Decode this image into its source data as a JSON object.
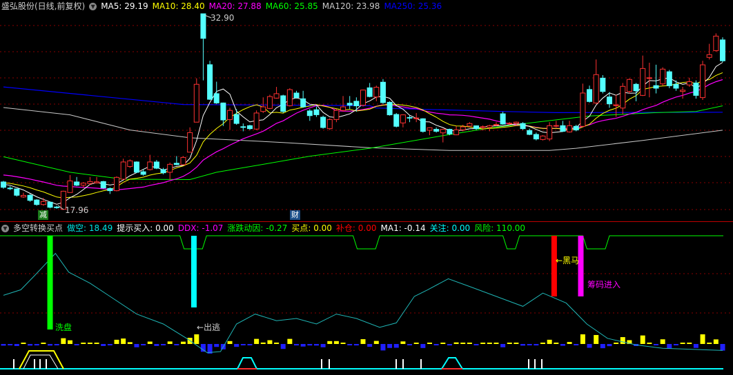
{
  "header": {
    "title": "盛弘股份(日线,前复权)",
    "ma": [
      {
        "label": "MA5: 29.19",
        "color": "#ffffff"
      },
      {
        "label": "MA10: 28.40",
        "color": "#ffff00"
      },
      {
        "label": "MA20: 27.88",
        "color": "#ff00ff"
      },
      {
        "label": "MA60: 25.85",
        "color": "#00ff00"
      },
      {
        "label": "MA120: 23.98",
        "color": "#c8c8c8"
      },
      {
        "label": "MA250: 25.36",
        "color": "#0000ff"
      }
    ]
  },
  "price_labels": {
    "high": "32.90",
    "low": "17.96"
  },
  "markers": {
    "jian": "减",
    "cai": "财"
  },
  "indicator": {
    "title": "多空转换买点",
    "values": [
      {
        "label": "做空: 18.49",
        "color": "#00e5e5"
      },
      {
        "label": "提示买入: 0.00",
        "color": "#ffffff"
      },
      {
        "label": "DDX: -1.07",
        "color": "#ff00ff"
      },
      {
        "label": "涨跌动因: -0.27",
        "color": "#00ff00"
      },
      {
        "label": "买点: 0.00",
        "color": "#ffff00"
      },
      {
        "label": "补仓: 0.00",
        "color": "#ff0000"
      },
      {
        "label": "MA1: -0.14",
        "color": "#ffffff"
      },
      {
        "label": "关注: 0.00",
        "color": "#00ffff"
      },
      {
        "label": "风险: 110.00",
        "color": "#00ff00"
      }
    ],
    "signals": {
      "wash": "洗盘",
      "escape": "←出逃",
      "darkhorse": "←黑马",
      "chips": "筹码进入"
    }
  },
  "chart_data": {
    "type": "candlestick",
    "price_range": [
      17.96,
      32.9
    ],
    "candles": [
      [
        20.02,
        19.61,
        20.1,
        19.5
      ],
      [
        19.55,
        19.52,
        19.7,
        19.4
      ],
      [
        19.49,
        19.0,
        19.5,
        18.9
      ],
      [
        18.87,
        18.99,
        19.2,
        18.8
      ],
      [
        19.0,
        18.61,
        19.1,
        18.5
      ],
      [
        18.64,
        18.29,
        18.7,
        18.2
      ],
      [
        18.29,
        18.52,
        18.8,
        18.2
      ],
      [
        18.47,
        18.08,
        18.5,
        18.0
      ],
      [
        18.1,
        18.06,
        18.2,
        17.96
      ],
      [
        17.92,
        19.31,
        19.35,
        17.92
      ],
      [
        19.21,
        20.1,
        20.55,
        19.2
      ],
      [
        20.02,
        19.77,
        20.4,
        19.7
      ],
      [
        19.77,
        19.93,
        20.0,
        19.6
      ],
      [
        19.9,
        20.05,
        20.4,
        19.8
      ],
      [
        19.95,
        20.03,
        20.4,
        19.9
      ],
      [
        20.05,
        19.56,
        20.1,
        19.5
      ],
      [
        19.52,
        19.35,
        19.6,
        19.1
      ],
      [
        19.35,
        20.37,
        20.45,
        19.3
      ],
      [
        20.23,
        21.55,
        21.8,
        20.2
      ],
      [
        21.2,
        21.64,
        21.75,
        21.1
      ],
      [
        21.55,
        20.76,
        21.6,
        20.7
      ],
      [
        20.8,
        20.6,
        21.0,
        20.5
      ],
      [
        20.97,
        21.55,
        22.1,
        20.9
      ],
      [
        21.55,
        21.07,
        21.7,
        21.0
      ],
      [
        20.97,
        20.72,
        21.1,
        20.6
      ],
      [
        20.76,
        21.37,
        21.5,
        20.2
      ],
      [
        21.45,
        21.35,
        22.0,
        21.3
      ],
      [
        21.34,
        21.9,
        22.0,
        21.3
      ],
      [
        22.3,
        23.8,
        24.2,
        22.3
      ],
      [
        24.6,
        27.5,
        27.96,
        24.6
      ],
      [
        32.9,
        31.02,
        32.9,
        27.8
      ],
      [
        29.0,
        26.35,
        29.3,
        26.3
      ],
      [
        26.78,
        26.07,
        27.7,
        26.0
      ],
      [
        26.07,
        24.77,
        26.1,
        24.3
      ],
      [
        24.8,
        25.5,
        25.7,
        24.0
      ],
      [
        25.19,
        24.5,
        25.6,
        24.4
      ],
      [
        24.25,
        24.2,
        24.5,
        23.9
      ],
      [
        24.33,
        24.1,
        24.4,
        24.0
      ],
      [
        24.07,
        25.3,
        25.5,
        24.0
      ],
      [
        25.42,
        25.77,
        26.5,
        25.3
      ],
      [
        25.65,
        26.56,
        26.7,
        25.6
      ],
      [
        26.44,
        26.78,
        27.3,
        26.4
      ],
      [
        26.62,
        25.42,
        26.7,
        25.3
      ],
      [
        25.86,
        27.09,
        27.2,
        25.8
      ],
      [
        26.83,
        26.48,
        27.0,
        26.4
      ],
      [
        26.39,
        25.77,
        27.0,
        25.7
      ],
      [
        25.46,
        25.1,
        25.6,
        24.7
      ],
      [
        25.55,
        25.17,
        25.8,
        25.0
      ],
      [
        24.98,
        24.19,
        25.1,
        24.1
      ],
      [
        24.1,
        24.8,
        24.9,
        24.0
      ],
      [
        24.8,
        25.5,
        25.6,
        24.6
      ],
      [
        25.5,
        25.77,
        26.6,
        25.4
      ],
      [
        26.05,
        25.9,
        26.6,
        25.6
      ],
      [
        26.2,
        25.85,
        26.5,
        25.4
      ],
      [
        25.9,
        27.06,
        27.1,
        25.8
      ],
      [
        27.23,
        26.56,
        27.6,
        26.5
      ],
      [
        26.53,
        27.27,
        27.4,
        26.2
      ],
      [
        27.66,
        26.1,
        27.9,
        26.0
      ],
      [
        26.12,
        25.16,
        26.2,
        25.1
      ],
      [
        25.19,
        24.28,
        25.3,
        24.2
      ],
      [
        24.54,
        25.16,
        25.2,
        24.2
      ],
      [
        24.96,
        24.94,
        25.1,
        24.6
      ],
      [
        24.88,
        24.92,
        25.3,
        24.6
      ],
      [
        24.86,
        23.89,
        24.9,
        23.8
      ],
      [
        23.98,
        24.17,
        24.2,
        23.6
      ],
      [
        24.05,
        23.9,
        24.2,
        23.8
      ],
      [
        23.78,
        24.05,
        24.1,
        23.05
      ],
      [
        24.05,
        23.7,
        24.1,
        23.6
      ],
      [
        23.63,
        24.01,
        24.3,
        23.6
      ],
      [
        24.01,
        24.24,
        24.4,
        23.9
      ],
      [
        24.3,
        24.49,
        24.6,
        24.2
      ],
      [
        24.32,
        24.1,
        24.35,
        24.0
      ],
      [
        24.2,
        24.25,
        24.35,
        23.95
      ],
      [
        24.2,
        24.33,
        24.4,
        23.9
      ],
      [
        24.4,
        24.42,
        24.6,
        24.3
      ],
      [
        25.24,
        24.45,
        25.4,
        24.4
      ],
      [
        24.5,
        24.52,
        24.6,
        24.4
      ],
      [
        24.5,
        24.6,
        24.65,
        24.4
      ],
      [
        24.5,
        24.1,
        24.6,
        24.0
      ],
      [
        23.96,
        23.66,
        24.1,
        23.6
      ],
      [
        23.66,
        23.31,
        23.8,
        23.2
      ],
      [
        23.27,
        23.54,
        23.6,
        23.2
      ],
      [
        23.31,
        24.33,
        24.6,
        23.15
      ],
      [
        24.3,
        24.34,
        24.7,
        24.2
      ],
      [
        24.33,
        23.9,
        24.7,
        23.85
      ],
      [
        23.85,
        24.33,
        24.7,
        23.8
      ],
      [
        24.28,
        24.0,
        24.4,
        23.9
      ],
      [
        24.28,
        26.83,
        27.55,
        24.2
      ],
      [
        27.1,
        26.18,
        27.4,
        26.1
      ],
      [
        26.07,
        28.24,
        29.4,
        26.0
      ],
      [
        27.97,
        26.95,
        28.2,
        26.8
      ],
      [
        26.53,
        26.0,
        26.9,
        25.7
      ],
      [
        25.9,
        25.92,
        26.7,
        25.0
      ],
      [
        25.68,
        27.34,
        27.6,
        25.2
      ],
      [
        26.95,
        27.87,
        27.95,
        26.8
      ],
      [
        27.5,
        27.0,
        27.6,
        26.2
      ],
      [
        26.65,
        28.71,
        29.7,
        26.6
      ],
      [
        27.95,
        28.0,
        29.15,
        26.5
      ],
      [
        27.4,
        27.2,
        29.0,
        26.8
      ],
      [
        27.53,
        28.66,
        28.8,
        27.4
      ],
      [
        28.46,
        27.39,
        28.6,
        27.2
      ],
      [
        27.5,
        27.2,
        27.8,
        27.0
      ],
      [
        26.95,
        27.05,
        27.3,
        26.4
      ],
      [
        27.45,
        27.7,
        28.0,
        27.3
      ],
      [
        27.6,
        26.65,
        27.8,
        26.4
      ],
      [
        26.48,
        28.99,
        29.3,
        26.3
      ],
      [
        29.56,
        29.77,
        30.6,
        29.4
      ],
      [
        30.08,
        31.19,
        31.4,
        30.0
      ],
      [
        30.9,
        29.3,
        31.1,
        29.2
      ]
    ],
    "ma60": [
      [
        0,
        21.95
      ],
      [
        10,
        20.76
      ],
      [
        18,
        20.23
      ],
      [
        28,
        20.2
      ],
      [
        32,
        20.76
      ],
      [
        39,
        21.37
      ],
      [
        46,
        21.99
      ],
      [
        55,
        22.6
      ],
      [
        66,
        23.57
      ],
      [
        73,
        24.15
      ],
      [
        80,
        24.6
      ],
      [
        88,
        25.07
      ],
      [
        98,
        25.33
      ],
      [
        104,
        25.42
      ],
      [
        108,
        25.85
      ]
    ],
    "ma120": [
      [
        0,
        25.72
      ],
      [
        10,
        25.16
      ],
      [
        19,
        24.0
      ],
      [
        28,
        23.4
      ],
      [
        42,
        23.04
      ],
      [
        55,
        22.64
      ],
      [
        67,
        22.43
      ],
      [
        82,
        22.43
      ],
      [
        86,
        22.6
      ],
      [
        96,
        23.2
      ],
      [
        108,
        23.98
      ]
    ],
    "ma250": [
      [
        0,
        27.3
      ],
      [
        27,
        25.95
      ],
      [
        55,
        25.86
      ],
      [
        56,
        25.68
      ],
      [
        75,
        25.42
      ],
      [
        83,
        25.33
      ],
      [
        108,
        25.36
      ]
    ],
    "indicator_curve": [
      [
        0,
        51
      ],
      [
        2.6,
        56
      ],
      [
        4.7,
        69
      ],
      [
        7.8,
        89
      ],
      [
        9.8,
        72
      ],
      [
        13,
        62
      ],
      [
        16,
        50
      ],
      [
        20,
        34
      ],
      [
        24,
        25
      ],
      [
        27.5,
        12
      ],
      [
        30.6,
        -1
      ],
      [
        32.6,
        0
      ],
      [
        35,
        25
      ],
      [
        37.8,
        34
      ],
      [
        41,
        28
      ],
      [
        44,
        30
      ],
      [
        47,
        25
      ],
      [
        50,
        34
      ],
      [
        53,
        30
      ],
      [
        56.5,
        22
      ],
      [
        59,
        26
      ],
      [
        61.7,
        50
      ],
      [
        63.7,
        56
      ],
      [
        66.8,
        66
      ],
      [
        70,
        59
      ],
      [
        74,
        50
      ],
      [
        78,
        41
      ],
      [
        81,
        53
      ],
      [
        84.5,
        44
      ],
      [
        87.6,
        25
      ],
      [
        90.7,
        12
      ],
      [
        95,
        6
      ],
      [
        99,
        3
      ],
      [
        108,
        1
      ]
    ],
    "signal_bars": [
      {
        "index": 7,
        "value": 20,
        "color": "#00ff00"
      },
      {
        "index": 28.6,
        "value": 40,
        "color": "#00ffff"
      },
      {
        "index": 82.7,
        "value": 50,
        "color": "#ff0000"
      },
      {
        "index": 86.7,
        "value": 50,
        "color": "#ff00ff"
      }
    ],
    "risk_dips": [
      [
        26.5,
        30.5
      ],
      [
        52.5,
        56.5
      ],
      [
        75,
        77.5
      ],
      [
        87,
        91
      ]
    ]
  }
}
